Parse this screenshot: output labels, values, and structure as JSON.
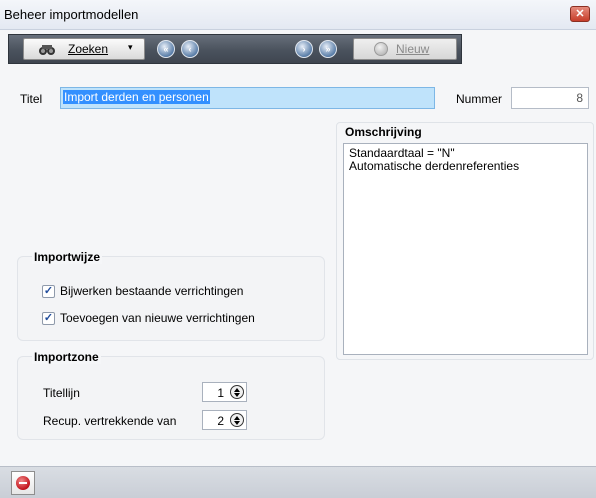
{
  "window": {
    "title": "Beheer importmodellen",
    "close_glyph": "✕"
  },
  "toolbar": {
    "search_label": "Zoeken",
    "search_icon": "binoculars-icon",
    "dropdown_glyph": "▾",
    "nav_first_glyph": "«",
    "nav_prev_glyph": "‹",
    "nav_next_glyph": "›",
    "nav_last_glyph": "»",
    "new_label": "Nieuw"
  },
  "form": {
    "titel_label": "Titel",
    "titel_value": "Import derden en personen",
    "nummer_label": "Nummer",
    "nummer_value": "8"
  },
  "omschrijving": {
    "title": "Omschrijving",
    "line1": "Standaardtaal = \"N\"",
    "line2": "Automatische derdenreferenties"
  },
  "importwijze": {
    "title": "Importwijze",
    "option1": {
      "label": "Bijwerken bestaande verrichtingen",
      "checked": true
    },
    "option2": {
      "label": "Toevoegen van nieuwe verrichtingen",
      "checked": true
    },
    "check_glyph": "✓"
  },
  "importzone": {
    "title": "Importzone",
    "titellijn_label": "Titellijn",
    "titellijn_value": "1",
    "recup_label": "Recup. vertrekkende van",
    "recup_value": "2"
  },
  "colors": {
    "toolbar_bg": "#4a525d",
    "selection_bg": "#3390ff",
    "input_highlight": "#bfe3fb",
    "stop_red": "#c1121a"
  }
}
